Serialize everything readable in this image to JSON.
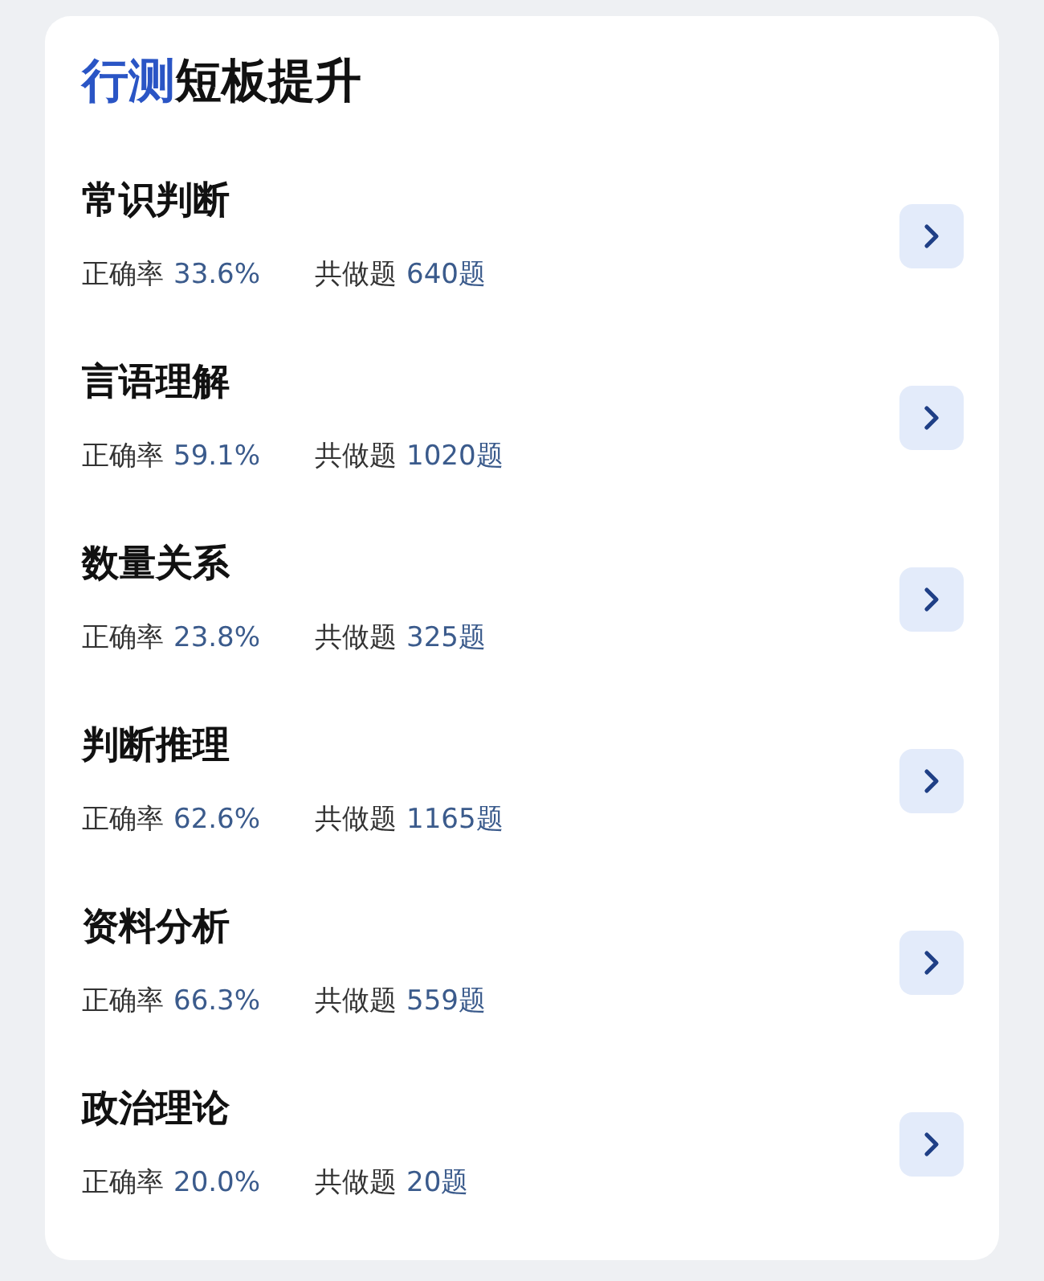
{
  "title": {
    "highlight": "行测",
    "rest": "短板提升"
  },
  "subjects": [
    {
      "name": "常识判断",
      "accuracy_label": "正确率",
      "accuracy": "33.6%",
      "count_label": "共做题",
      "count": "640题"
    },
    {
      "name": "言语理解",
      "accuracy_label": "正确率",
      "accuracy": "59.1%",
      "count_label": "共做题",
      "count": "1020题"
    },
    {
      "name": "数量关系",
      "accuracy_label": "正确率",
      "accuracy": "23.8%",
      "count_label": "共做题",
      "count": "325题"
    },
    {
      "name": "判断推理",
      "accuracy_label": "正确率",
      "accuracy": "62.6%",
      "count_label": "共做题",
      "count": "1165题"
    },
    {
      "name": "资料分析",
      "accuracy_label": "正确率",
      "accuracy": "66.3%",
      "count_label": "共做题",
      "count": "559题"
    },
    {
      "name": "政治理论",
      "accuracy_label": "正确率",
      "accuracy": "20.0%",
      "count_label": "共做题",
      "count": "20题"
    }
  ]
}
